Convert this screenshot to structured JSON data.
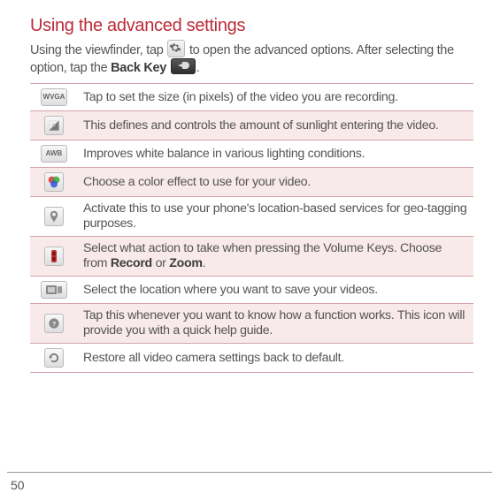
{
  "title": "Using the advanced settings",
  "intro": {
    "part1": "Using the viewfinder, tap ",
    "part2": " to open the advanced options. After selecting the option, tap the ",
    "back_key_label": "Back Key",
    "period": "."
  },
  "rows": [
    {
      "icon": "wvga-icon",
      "desc": "Tap to set the size (in pixels) of the video you are recording."
    },
    {
      "icon": "brightness-icon",
      "desc": "This defines and controls the amount of sunlight entering the video."
    },
    {
      "icon": "awb-icon",
      "desc": "Improves white balance in various lighting conditions."
    },
    {
      "icon": "color-effect-icon",
      "desc": "Choose a color effect to use for your video."
    },
    {
      "icon": "geotag-icon",
      "desc": "Activate this to use your phone's location-based services for geo-tagging purposes."
    },
    {
      "icon": "volume-key-icon",
      "desc_pre": "Select what action to take when pressing the Volume Keys. Choose from ",
      "bold1": "Record",
      "mid": " or ",
      "bold2": "Zoom",
      "post": "."
    },
    {
      "icon": "storage-icon",
      "desc": "Select the location where you want to save your videos."
    },
    {
      "icon": "help-icon",
      "desc": "Tap this whenever you want to know how a function works. This icon will provide you with a quick help guide."
    },
    {
      "icon": "reset-icon",
      "desc": "Restore all video camera settings back to default."
    }
  ],
  "page_number": "50"
}
